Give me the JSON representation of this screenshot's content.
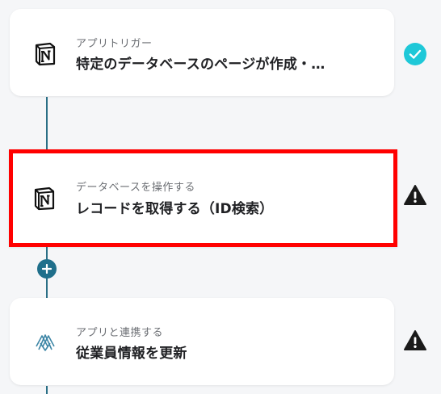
{
  "steps": [
    {
      "subtitle": "アプリトリガー",
      "title": "特定のデータベースのページが作成・…",
      "app_icon": "notion-icon",
      "status_icon": "check-circle-icon"
    },
    {
      "subtitle": "データベースを操作する",
      "title": "レコードを取得する（ID検索）",
      "app_icon": "notion-icon",
      "status_icon": "warning-icon"
    },
    {
      "subtitle": "アプリと連携する",
      "title": "従業員情報を更新",
      "app_icon": "hr-app-icon",
      "status_icon": "warning-icon"
    }
  ],
  "add_step": {
    "icon": "plus-icon"
  },
  "colors": {
    "connector": "#2a6f86",
    "check": "#1ec8d8",
    "selection": "#ff0000",
    "warning": "#1a1a1a"
  }
}
